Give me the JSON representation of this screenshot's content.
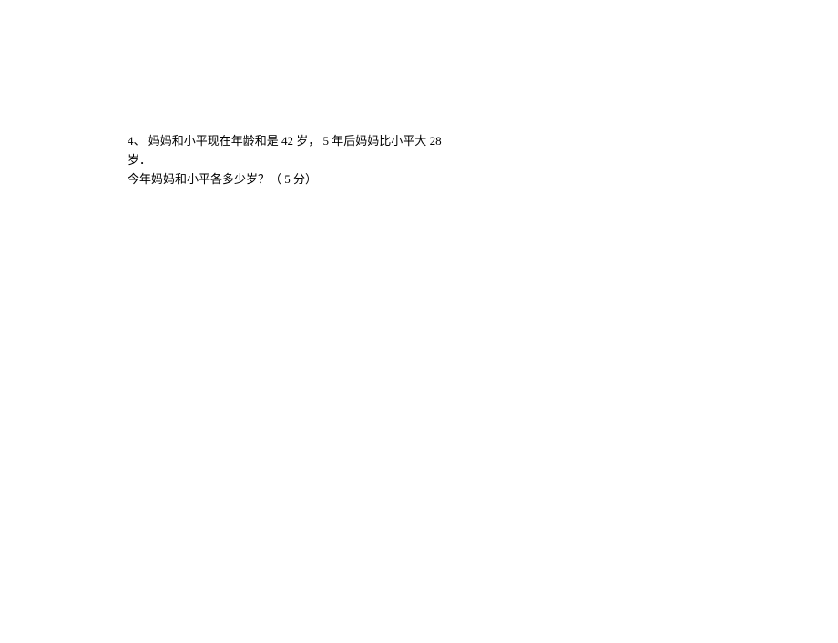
{
  "problem": {
    "number": "4、",
    "line1_part1": "妈妈和小平现在年龄和是",
    "line1_value1": "42",
    "line1_part2": "岁，",
    "line1_value2": "5",
    "line1_part3": "年后妈妈比小平大",
    "line1_value3": "28",
    "line2": "岁．",
    "line3_part1": "今年妈妈和小平各多少岁？（",
    "line3_value": "5",
    "line3_part2": "分）"
  }
}
